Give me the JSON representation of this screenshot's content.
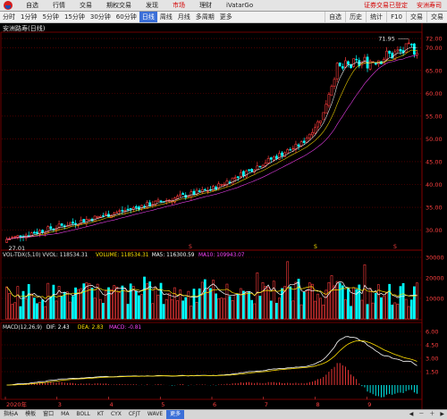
{
  "menu": {
    "items": [
      "自选",
      "行情",
      "交易",
      "期权交易",
      "发现",
      "市场",
      "理财",
      "iVatarGo"
    ],
    "active": "市场",
    "right": [
      "证券交易已登定",
      "安洲寿司"
    ]
  },
  "toolbar": {
    "items": [
      "分时",
      "1分钟",
      "5分钟",
      "15分钟",
      "30分钟",
      "60分钟",
      "日线",
      "周线",
      "月线",
      "多周期",
      "更多"
    ],
    "active": "日线",
    "right": [
      "自选",
      "历史",
      "统计",
      "F10",
      "交易",
      "交易"
    ]
  },
  "stock": {
    "title": "安洲路寿(日线)",
    "high_label": "71.95",
    "low_label": "27.01"
  },
  "price_axis": {
    "labels": [
      "72.00",
      "70.00",
      "65.00",
      "60.00",
      "55.00",
      "50.00",
      "45.00",
      "40.00",
      "35.00",
      "30.00"
    ]
  },
  "event_marks": [
    "S",
    "S",
    "S"
  ],
  "volume": {
    "legend": [
      {
        "text": "VOL-TDX(5,10) VVOL: 118534.31",
        "color": "#e6e6e6"
      },
      {
        "text": "VOLUME: 118534.31",
        "color": "#ffe000"
      },
      {
        "text": "MA5: 116300.59",
        "color": "#ffffff"
      },
      {
        "text": "MA10: 109943.07",
        "color": "#ff44ff"
      }
    ],
    "axis": [
      "30000",
      "20000",
      "10000"
    ]
  },
  "macd": {
    "legend": [
      {
        "text": "MACD(12,26,9)",
        "color": "#e6e6e6"
      },
      {
        "text": "DIF: 2.43",
        "color": "#ffffff"
      },
      {
        "text": "DEA: 2.83",
        "color": "#ffe000"
      },
      {
        "text": "MACD: -0.81",
        "color": "#ff44ff"
      }
    ],
    "axis": [
      "6.00",
      "4.50",
      "3.00",
      "1.50"
    ]
  },
  "date_axis": {
    "labels": [
      "2020年",
      "3",
      "4",
      "5",
      "6",
      "7",
      "8",
      "9"
    ]
  },
  "bottombar": {
    "items": [
      "指标A",
      "模板",
      "窗口",
      "MA",
      "BOLL",
      "KT",
      "CYX",
      "CFJT",
      "WAVE",
      "更多"
    ],
    "active": "更多"
  },
  "colors": {
    "up": "#ff3b3b",
    "down": "#00ffff",
    "grid": "#7a0000",
    "axis_text": "#ff4040",
    "ma5": "#ffffff",
    "ma10": "#ffe000",
    "ma20": "#ff44ff",
    "accent": "#3b6fd8"
  }
}
